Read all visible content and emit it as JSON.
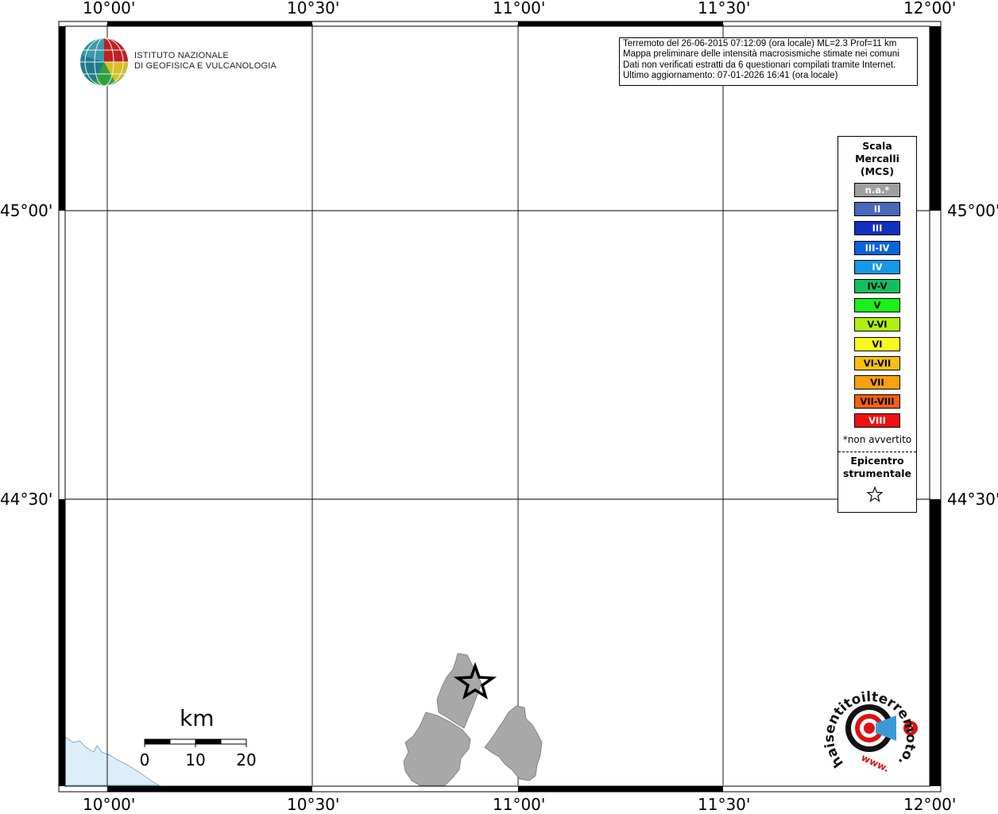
{
  "axes": {
    "lon_labels": [
      "10°00'",
      "10°30'",
      "11°00'",
      "11°30'",
      "12°00'"
    ],
    "lat_labels": [
      "45°00'",
      "44°30'"
    ]
  },
  "logo": {
    "line1": "ISTITUTO NAZIONALE",
    "line2": "DI GEOFISICA E VULCANOLOGIA"
  },
  "info": {
    "line1": "Terremoto del 26-06-2015 07:12:09 (ora locale) ML=2.3 Prof=11 km",
    "line2": "Mappa preliminare delle intensità macrosismiche stimate nei comuni",
    "line3": "Dati non verificati estratti da 6 questionari compilati tramite Internet.",
    "line4": "Ultimo aggiornamento: 07-01-2026 16:41 (ora locale)"
  },
  "legend": {
    "title_line1": "Scala",
    "title_line2": "Mercalli",
    "title_line3": "(MCS)",
    "classes": [
      {
        "label": "n.a.*",
        "color": "#a0a0a0",
        "text_color": "#ffffff"
      },
      {
        "label": "II",
        "color": "#4a68b8",
        "text_color": "#ffffff"
      },
      {
        "label": "III",
        "color": "#1030c0",
        "text_color": "#ffffff"
      },
      {
        "label": "III-IV",
        "color": "#0a64dc",
        "text_color": "#ffffff"
      },
      {
        "label": "IV",
        "color": "#1498e8",
        "text_color": "#ffffff"
      },
      {
        "label": "IV-V",
        "color": "#10c060",
        "text_color": "#000000"
      },
      {
        "label": "V",
        "color": "#18f018",
        "text_color": "#000000"
      },
      {
        "label": "V-VI",
        "color": "#b0f010",
        "text_color": "#000000"
      },
      {
        "label": "VI",
        "color": "#f8f820",
        "text_color": "#000000"
      },
      {
        "label": "VI-VII",
        "color": "#f8c010",
        "text_color": "#000000"
      },
      {
        "label": "VII",
        "color": "#f8a010",
        "text_color": "#000000"
      },
      {
        "label": "VII-VIII",
        "color": "#f06010",
        "text_color": "#000000"
      },
      {
        "label": "VIII",
        "color": "#f01010",
        "text_color": "#ffffff"
      }
    ],
    "note": "*non avvertito",
    "epicenter_line1": "Epicentro",
    "epicenter_line2": "strumentale"
  },
  "scalebar": {
    "unit": "km",
    "ticks": [
      "0",
      "10",
      "20"
    ]
  },
  "brand": {
    "text": "haisentitoilterremoto.it",
    "www": "www."
  },
  "colors": {
    "municipality_fill": "#a8a8a8",
    "sea": "#dbeefa",
    "frame": "#000000"
  },
  "symbols": {
    "epicenter": "star-icon"
  }
}
